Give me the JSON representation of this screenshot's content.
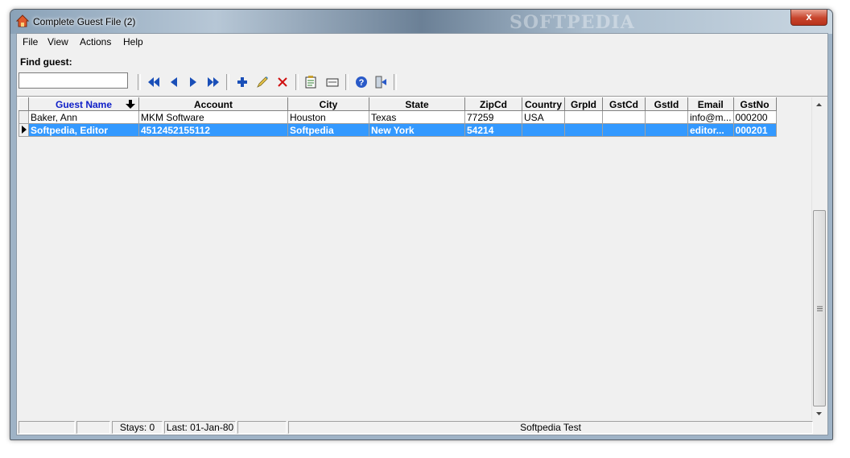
{
  "window": {
    "title": "Complete Guest File (2)",
    "watermark": "SOFTPEDIA",
    "close_label": "x"
  },
  "menu": [
    "File",
    "View",
    "Actions",
    "Help"
  ],
  "find": {
    "label": "Find guest:",
    "value": "",
    "placeholder": ""
  },
  "toolbar": {
    "buttons": [
      "first-record-icon",
      "previous-record-icon",
      "next-record-icon",
      "last-record-icon",
      "add-guest-icon",
      "edit-guest-icon",
      "delete-guest-icon",
      "guest-report-icon",
      "guest-card-icon",
      "help-icon",
      "exit-icon"
    ],
    "colors": {
      "nav": "#1a4fb8",
      "add": "#1a4fb8",
      "delete": "#d01010"
    }
  },
  "grid": {
    "columns": [
      "Guest Name",
      "Account",
      "City",
      "State",
      "ZipCd",
      "Country",
      "GrpId",
      "GstCd",
      "GstId",
      "Email",
      "GstNo"
    ],
    "sorted_column": "Guest Name",
    "rows": [
      {
        "cells": [
          "Baker, Ann",
          "MKM Software",
          "Houston",
          "Texas",
          "77259",
          "USA",
          "",
          "",
          "",
          "info@m...",
          "000200"
        ],
        "selected": false
      },
      {
        "cells": [
          "Softpedia, Editor",
          "4512452155112",
          "Softpedia",
          "New York",
          "54214",
          "",
          "",
          "",
          "",
          "editor...",
          "000201"
        ],
        "selected": true
      }
    ],
    "selection_color": "#3399ff"
  },
  "status": {
    "stays": "Stays: 0",
    "last": "Last: 01-Jan-80",
    "message": "Softpedia Test"
  }
}
